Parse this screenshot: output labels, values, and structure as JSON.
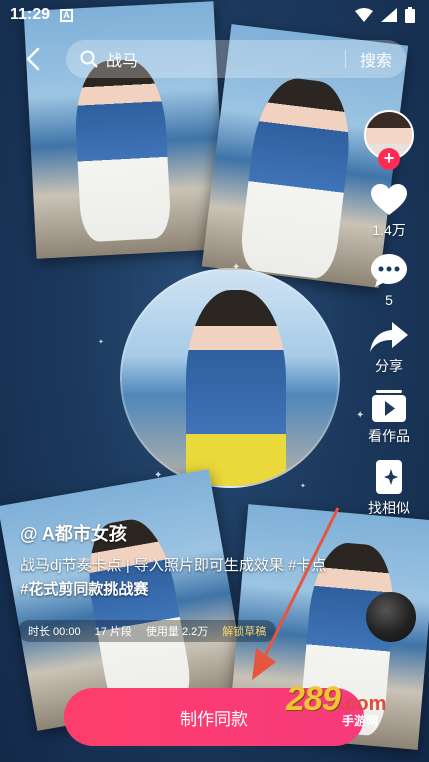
{
  "status_bar": {
    "time": "11:29",
    "a_indicator": "A"
  },
  "search": {
    "query": "战马",
    "button_label": "搜索"
  },
  "rail": {
    "likes": "1.4万",
    "comments": "5",
    "share_label": "分享",
    "works_label": "看作品",
    "similar_label": "找相似"
  },
  "author": "@ A都市女孩",
  "description": {
    "line1": "战马dj节奏卡点 | 导入照片即可生成效果 #卡点",
    "line2": "#花式剪同款挑战赛"
  },
  "meta": {
    "duration": "时长 00:00",
    "segments": "17 片段",
    "usage": "使用量 2.2万",
    "unlock": "解锁草稿"
  },
  "make_button": "制作同款",
  "watermark": {
    "number": "289",
    "suffix": ".com",
    "sub": "手游网"
  },
  "colors": {
    "accent": "#fe2c55",
    "button": "#fd3e6b",
    "arrow": "#e6553f"
  }
}
